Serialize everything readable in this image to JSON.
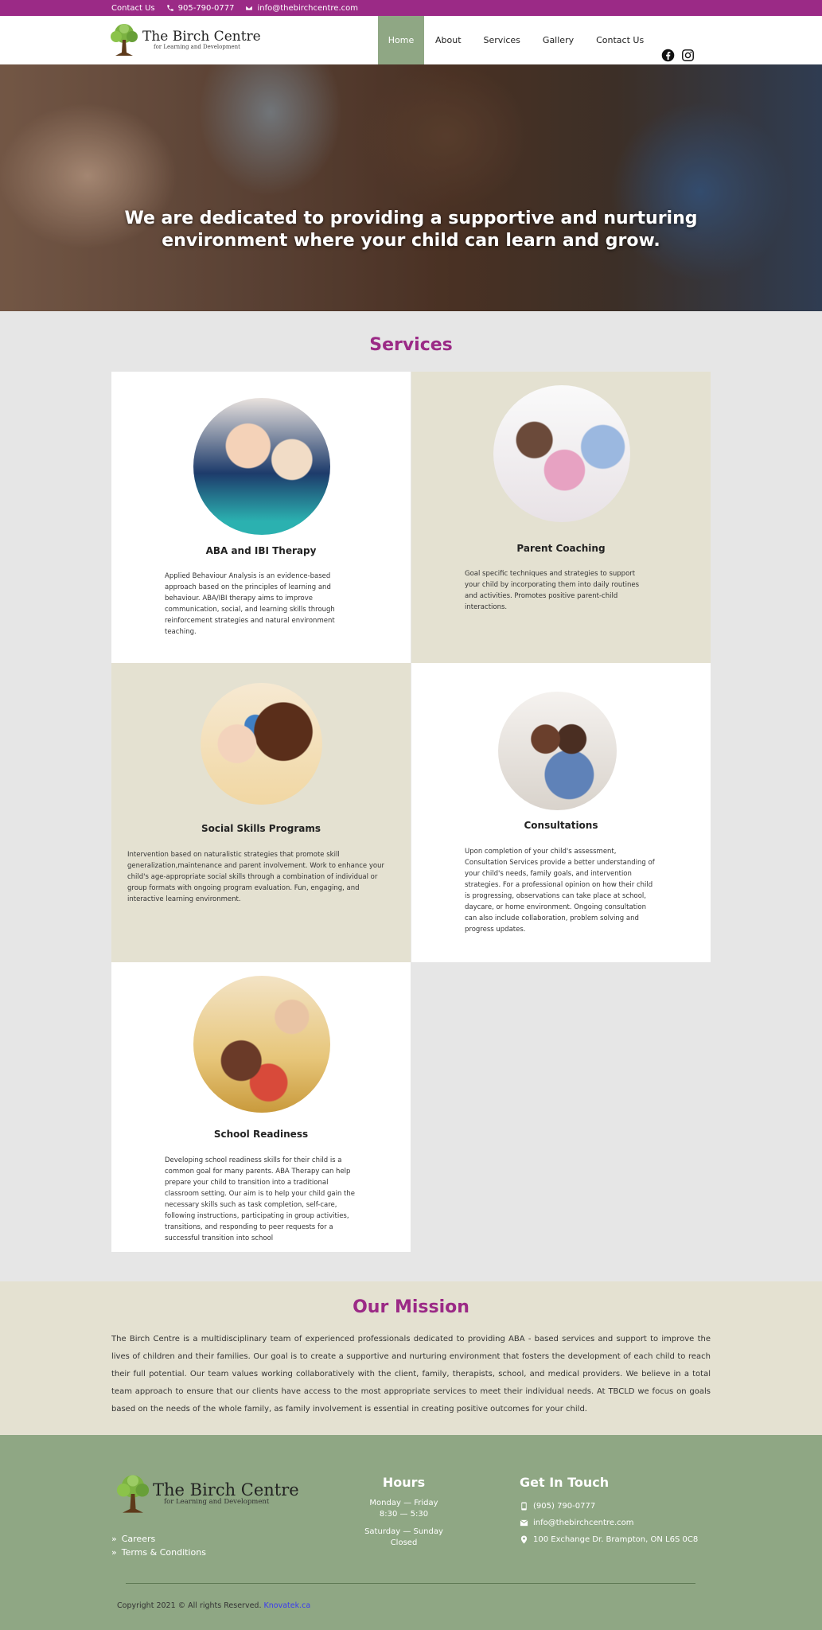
{
  "topbar": {
    "contact_label": "Contact Us",
    "phone": "905-790-0777",
    "email": "info@thebirchcentre.com"
  },
  "header": {
    "logo_name": "The Birch Centre",
    "logo_tagline": "for Learning and Development",
    "nav": [
      "Home",
      "About",
      "Services",
      "Gallery",
      "Contact Us"
    ],
    "active_nav": "Home",
    "social_icons": [
      "facebook-icon",
      "instagram-icon"
    ]
  },
  "hero": {
    "headline_line1": "We are dedicated to providing a supportive and nurturing",
    "headline_line2": "environment where your child can learn and grow."
  },
  "services": {
    "title": "Services",
    "cards": [
      {
        "title": "ABA and IBI Therapy",
        "text": "Applied Behaviour Analysis is an evidence-based approach based on the principles of learning and behaviour. ABA/IBI therapy aims to improve communication, social, and learning skills through reinforcement strategies and natural environment teaching."
      },
      {
        "title": "Parent Coaching",
        "text": "Goal specific techniques and strategies to support your child by incorporating them into daily routines and activities. Promotes positive parent-child interactions."
      },
      {
        "title": "Social Skills Programs",
        "text": "Intervention based on naturalistic strategies that promote skill generalization,maintenance and parent involvement. Work to enhance your child's age-appropriate social skills through a combination of individual or group formats with ongoing program evaluation. Fun, engaging, and interactive learning environment."
      },
      {
        "title": "Consultations",
        "text": "Upon completion of your child's assessment, Consultation Services provide a better understanding of your child's needs, family goals, and intervention strategies. For a professional opinion on how their child is progressing, observations can take place at school, daycare, or home environment. Ongoing consultation can also include collaboration, problem solving and progress updates."
      },
      {
        "title": "School Readiness",
        "text": "Developing school readiness skills for their child is a common goal for many parents. ABA Therapy can help prepare your child to transition into a traditional classroom setting. Our aim is to help your child gain the necessary skills such as task completion, self-care, following instructions, participating in group activities, transitions, and responding to peer requests for a successful transition into school"
      }
    ]
  },
  "mission": {
    "title": "Our Mission",
    "text": "The Birch Centre is a multidisciplinary team of experienced professionals dedicated to providing ABA - based services and support to improve the lives of children and their families. Our goal is to create a supportive and nurturing environment that fosters the development of each child to reach their full potential. Our team values working collaboratively with the client, family, therapists, school, and medical providers. We believe in a total team approach to ensure that our clients have access to the most appropriate services to meet their individual needs. At TBCLD we focus on goals based on the needs of the whole family, as family involvement is essential in creating positive outcomes for your child."
  },
  "footer": {
    "logo_name": "The Birch Centre",
    "logo_tagline": "for Learning and Development",
    "links": [
      "Careers",
      "Terms & Conditions"
    ],
    "hours_title": "Hours",
    "hours_weekday_days": "Monday — Friday",
    "hours_weekday_time": "8:30 — 5:30",
    "hours_weekend_days": "Saturday — Sunday",
    "hours_weekend_status": "Closed",
    "touch_title": "Get In Touch",
    "phone": "(905) 790-0777",
    "email": "info@thebirchcentre.com",
    "address": "100 Exchange Dr. Brampton, ON L6S 0C8",
    "copyright": "Copyright 2021 © All rights Reserved.",
    "credit_link": "Knovatek.ca"
  },
  "colors": {
    "brand_purple": "#9b2a86",
    "sage_green": "#8fa784",
    "tan": "#e4e1d1"
  }
}
